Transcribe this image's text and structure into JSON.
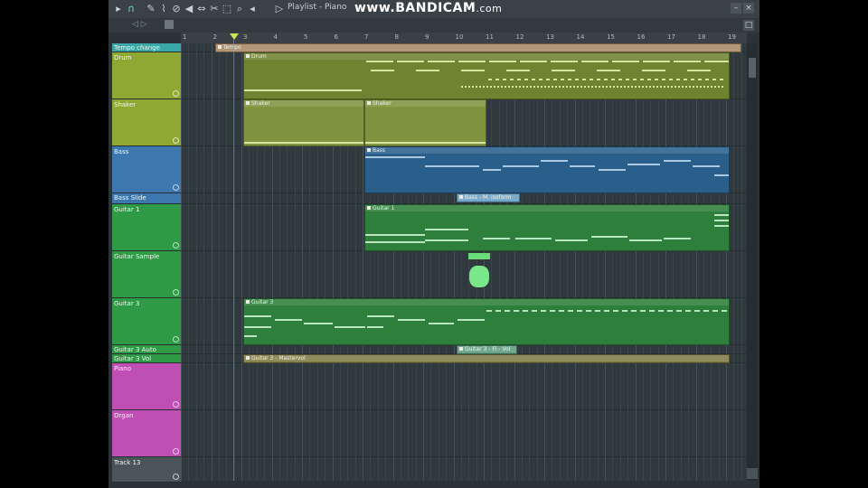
{
  "window": {
    "title": "Playlist - Piano",
    "watermark_brand": "www.BANDICAM",
    "watermark_domain": ".com"
  },
  "toolbar": {
    "icons": [
      "arrow-right-icon",
      "headphone-icon",
      "pencil-icon",
      "brush-icon",
      "mute-icon",
      "slip-icon",
      "slice-icon",
      "select-icon",
      "zoom-icon",
      "speaker-icon",
      "play-pattern-icon"
    ],
    "nav": "◁ ▷"
  },
  "ruler": {
    "bars": [
      "1",
      "2",
      "3",
      "4",
      "5",
      "6",
      "7",
      "8",
      "9",
      "10",
      "11",
      "12",
      "13",
      "14",
      "15",
      "16",
      "17",
      "18",
      "19"
    ]
  },
  "tracks": [
    {
      "name": "Tempo change",
      "color": "#3aa8a6"
    },
    {
      "name": "Drum",
      "color": "#8fa834"
    },
    {
      "name": "Shaker",
      "color": "#8fa834"
    },
    {
      "name": "Bass",
      "color": "#3c77ad"
    },
    {
      "name": "Bass Slide",
      "color": "#3c77ad"
    },
    {
      "name": "Guitar 1",
      "color": "#2f9a45"
    },
    {
      "name": "Guitar Sample",
      "color": "#2f9a45"
    },
    {
      "name": "Guitar 3",
      "color": "#2f9a45"
    },
    {
      "name": "Guitar 3 Auto",
      "color": "#2f9a45"
    },
    {
      "name": "Guitar 3 Vol",
      "color": "#2f9a45"
    },
    {
      "name": "Piano",
      "color": "#c04fb3"
    },
    {
      "name": "Organ",
      "color": "#c04fb3"
    },
    {
      "name": "Track 13",
      "color": "#4a555a"
    }
  ],
  "clips": {
    "tempo": "Tempo",
    "drum": "Drum",
    "shaker_1": "Shaker",
    "shaker_2": "Shaker",
    "bass": "Bass",
    "bass_slide": "Bass - M. isoform",
    "guitar1": "Guitar 1",
    "guitar3": "Guitar 3",
    "guitar3_auto": "Guitar 3 - Fl - Vol",
    "guitar3_vol": "Guitar 3 - Mastervol"
  }
}
